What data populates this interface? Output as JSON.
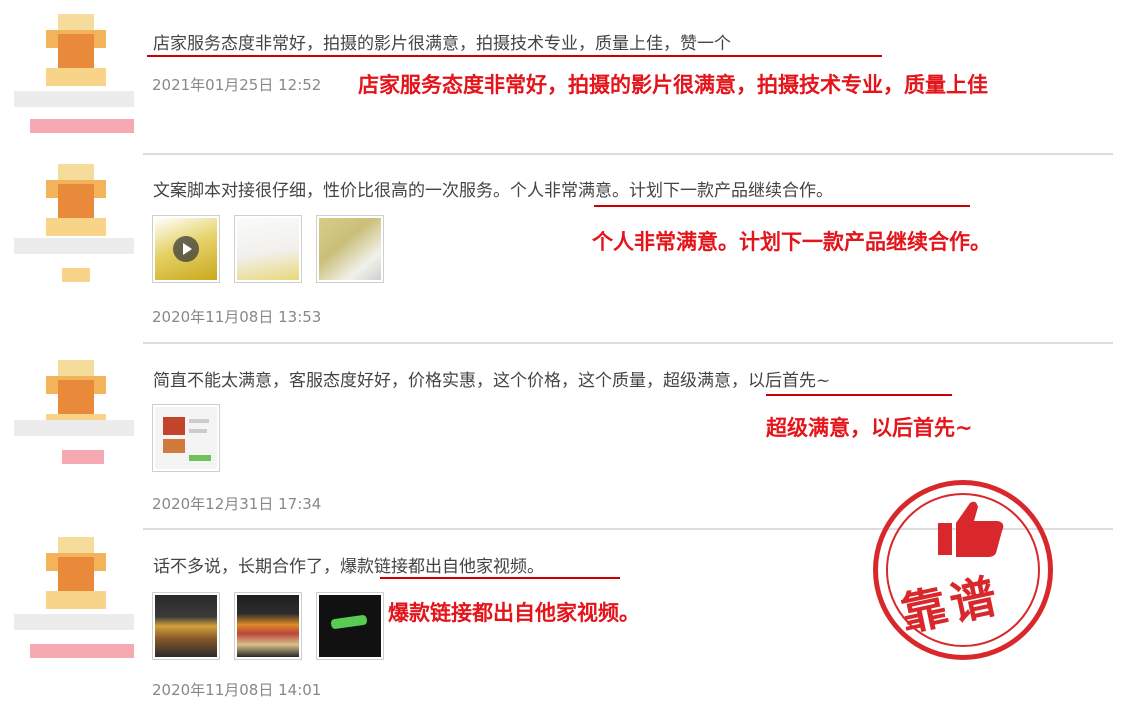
{
  "colors": {
    "annotation": "#e4141b",
    "stamp": "#d9282b",
    "divider": "#dcdcdc",
    "date": "#888888"
  },
  "reviews": [
    {
      "comment": "店家服务态度非常好，拍摄的影片很满意，拍摄技术专业，质量上佳，赞一个",
      "date": "2021年01月25日 12:52",
      "annotation": "店家服务态度非常好，拍摄的影片很满意，拍摄技术专业，质量上佳",
      "thumbnails": []
    },
    {
      "comment": "文案脚本对接很仔细，性价比很高的一次服务。个人非常满意。计划下一款产品继续合作。",
      "date": "2020年11月08日 13:53",
      "annotation": "个人非常满意。计划下一款产品继续合作。",
      "thumbnails": [
        "video-thumbnail",
        "photo-thumbnail",
        "photo-thumbnail"
      ]
    },
    {
      "comment": "简直不能太满意，客服态度好好，价格实惠，这个价格，这个质量，超级满意，以后首先~",
      "date": "2020年12月31日 17:34",
      "annotation": "超级满意，以后首先~",
      "thumbnails": [
        "chat-screenshot-thumbnail"
      ]
    },
    {
      "comment": "话不多说，长期合作了，爆款链接都出自他家视频。",
      "date": "2020年11月08日 14:01",
      "annotation": "爆款链接都出自他家视频。",
      "thumbnails": [
        "photo-thumbnail",
        "photo-thumbnail",
        "photo-thumbnail"
      ]
    }
  ],
  "stamp": {
    "text": "靠谱",
    "icon": "thumbs-up-icon"
  }
}
